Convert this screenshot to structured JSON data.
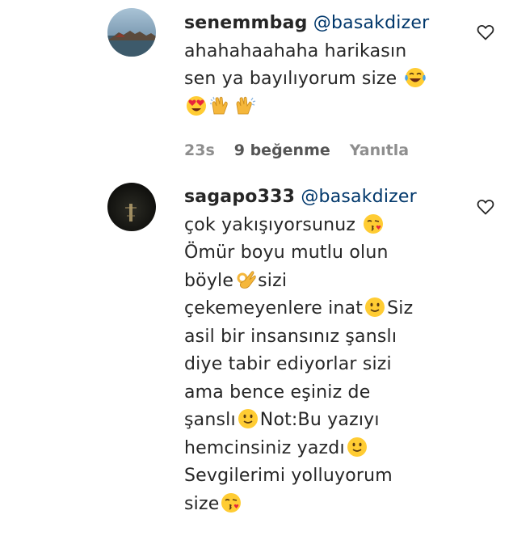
{
  "comments": [
    {
      "username": "senemmbag",
      "mention": "@basakdizer",
      "text_lines": [
        "ahahahaahaha harikasın",
        "sen ya bayılıyorum size"
      ],
      "emojis": [
        "face-with-tears-of-joy",
        "heart-eyes-face",
        "clapping-hands",
        "clapping-hands"
      ],
      "time": "23s",
      "likes": "9 beğenme",
      "reply_label": "Yanıtla"
    },
    {
      "username": "sagapo333",
      "mention": "@basakdizer",
      "text_lines": [
        "çok yakışıyorsunuz",
        "Ömür boyu mutlu olun",
        "böyle",
        "sizi",
        "çekemeyenlere inat",
        "Siz",
        "asil bir insansınız şanslı",
        "diye tabir ediyorlar sizi",
        "ama bence eşiniz de",
        "şanslı",
        "Not:Bu yazıyı",
        "hemcinsiniz yazdı",
        "Sevgilerimi yolluyorum",
        "size"
      ],
      "emojis": [
        "kissing-face-with-heart",
        "ok-hand",
        "slightly-smiling-face",
        "slightly-smiling-face",
        "slightly-smiling-face",
        "kissing-face-with-heart"
      ]
    }
  ],
  "colors": {
    "text": "#262626",
    "mention": "#00376b",
    "meta": "#8e8e8e"
  },
  "icons": [
    "heart-outline-icon"
  ]
}
